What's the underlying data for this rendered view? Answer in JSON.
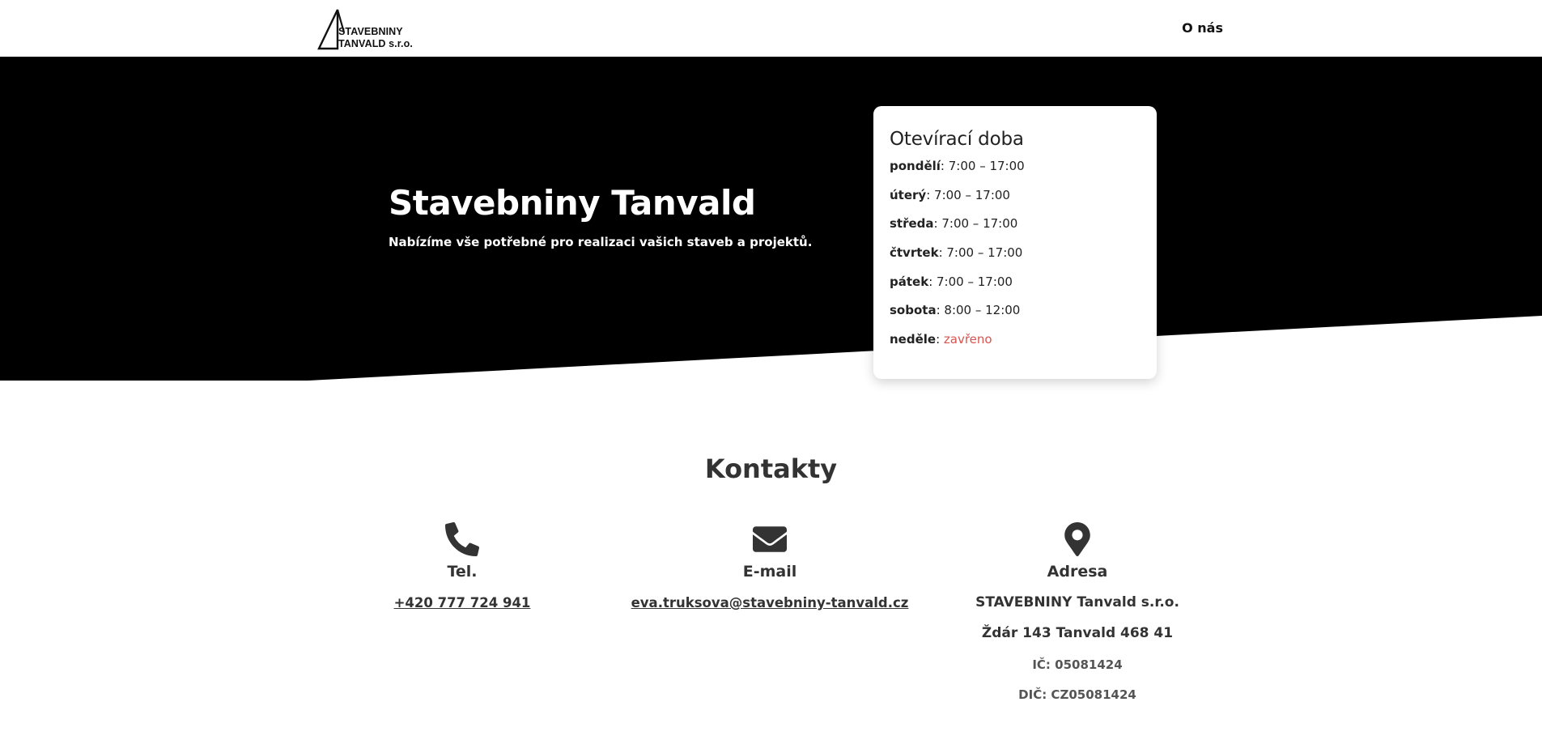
{
  "header": {
    "logo_line1": "STAVEBNINY",
    "logo_line2": "TANVALD s.r.o.",
    "nav_about": "O nás"
  },
  "hero": {
    "title": "Stavebniny Tanvald",
    "subtitle": "Nabízíme vše potřebné pro realizaci vašich staveb a projektů."
  },
  "hours": {
    "title": "Otevírací doba",
    "rows": [
      {
        "day": "pondělí",
        "time": "7:00 – 17:00"
      },
      {
        "day": "úterý",
        "time": "7:00 – 17:00"
      },
      {
        "day": "středa",
        "time": "7:00 – 17:00"
      },
      {
        "day": "čtvrtek",
        "time": "7:00 – 17:00"
      },
      {
        "day": "pátek",
        "time": "7:00 – 17:00"
      },
      {
        "day": "sobota",
        "time": "8:00 – 12:00"
      },
      {
        "day": "neděle",
        "time": "zavřeno"
      }
    ],
    "closed_color": "#d9534f"
  },
  "contacts": {
    "title": "Kontakty",
    "phone": {
      "icon": "phone-icon",
      "label": "Tel.",
      "value": "+420 777 724 941"
    },
    "email": {
      "icon": "envelope-icon",
      "label": "E-mail",
      "value": "eva.truksova@stavebniny-tanvald.cz"
    },
    "address": {
      "icon": "map-pin-icon",
      "label": "Adresa",
      "company": "STAVEBNINY Tanvald s.r.o.",
      "street": "Ždár 143 Tanvald 468 41",
      "ic": "IČ: 05081424",
      "dic": "DIČ: CZ05081424"
    }
  },
  "colors": {
    "hero_bg": "#000000",
    "text_dark": "#333333",
    "page_bg": "#ffffff"
  }
}
